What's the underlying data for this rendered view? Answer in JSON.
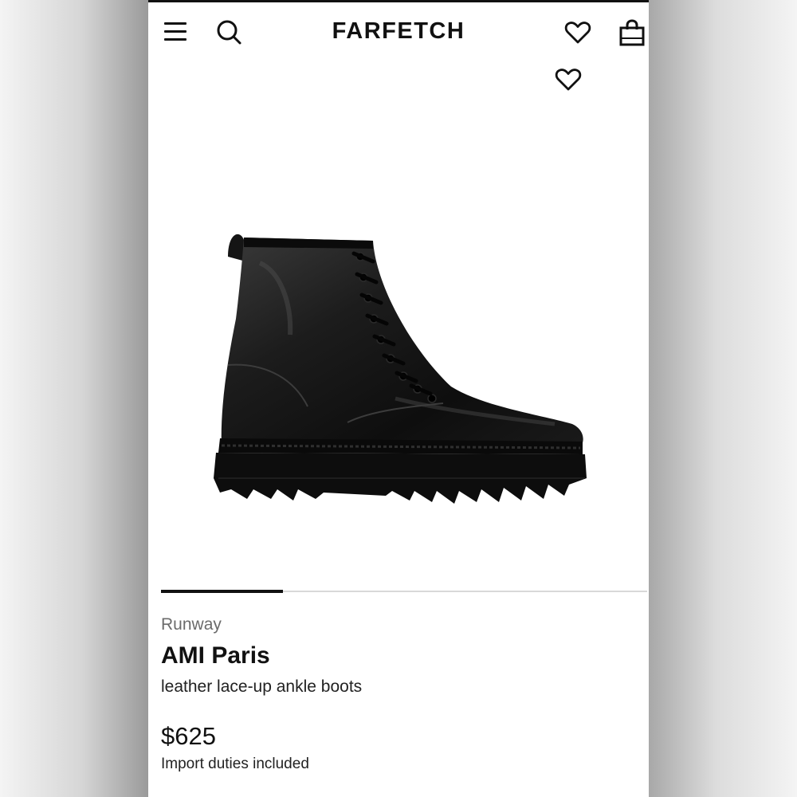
{
  "header": {
    "logo": "FARFETCH",
    "icons": [
      "menu-icon",
      "search-icon",
      "heart-icon",
      "shopping-bag-icon"
    ]
  },
  "product": {
    "image_icon": "boot-photo",
    "wishlist_icon": "heart-icon",
    "label": "Runway",
    "brand": "AMI Paris",
    "name": "leather lace-up ankle boots",
    "price": "$625",
    "duties_note": "Import duties included",
    "gallery_progress_fraction": 0.25
  },
  "colors": {
    "text_primary": "#111111",
    "text_muted": "#6b6b6b",
    "background": "#ffffff",
    "track": "#d8d8d8"
  }
}
